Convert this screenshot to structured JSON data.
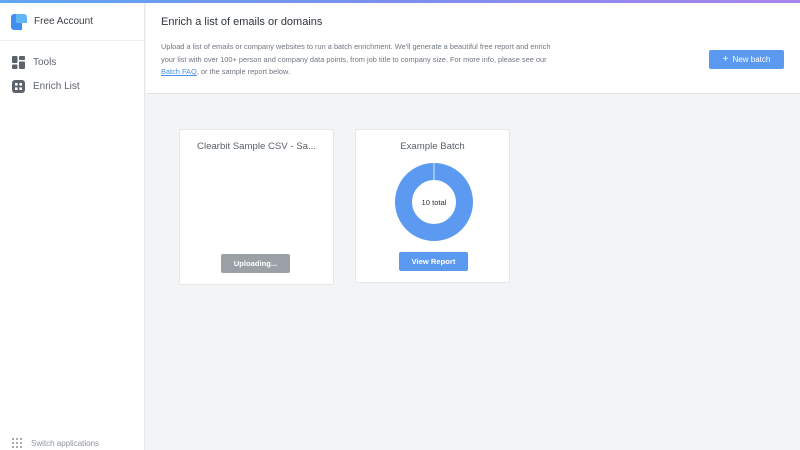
{
  "account": {
    "name": "Free Account"
  },
  "sidebar": {
    "items": [
      {
        "label": "Tools",
        "icon": "tools-icon"
      },
      {
        "label": "Enrich List",
        "icon": "enrich-list-icon"
      }
    ],
    "switch_label": "Switch applications"
  },
  "header": {
    "title": "Enrich a list of emails or domains",
    "desc_before": "Upload a list of emails or company websites to run a batch enrichment. We'll generate a beautiful free report and enrich your list with over 100+ person and company data points, from job title to company size. For more info, please see our ",
    "faq_link": "Batch FAQ",
    "desc_after": ", or the sample report below.",
    "new_batch_label": "New batch"
  },
  "cards": [
    {
      "title": "Clearbit Sample CSV - Sa...",
      "button": "Uploading..."
    },
    {
      "title": "Example Batch",
      "donut_label": "10 total",
      "button": "View Report"
    }
  ],
  "chart_data": {
    "type": "pie",
    "categories": [
      ""
    ],
    "values": [
      10
    ],
    "colors": [
      "#5b9af0"
    ]
  },
  "colors": {
    "accent": "#5b9af0",
    "disabled": "#9aa0a6",
    "link": "#4a8fe8"
  }
}
